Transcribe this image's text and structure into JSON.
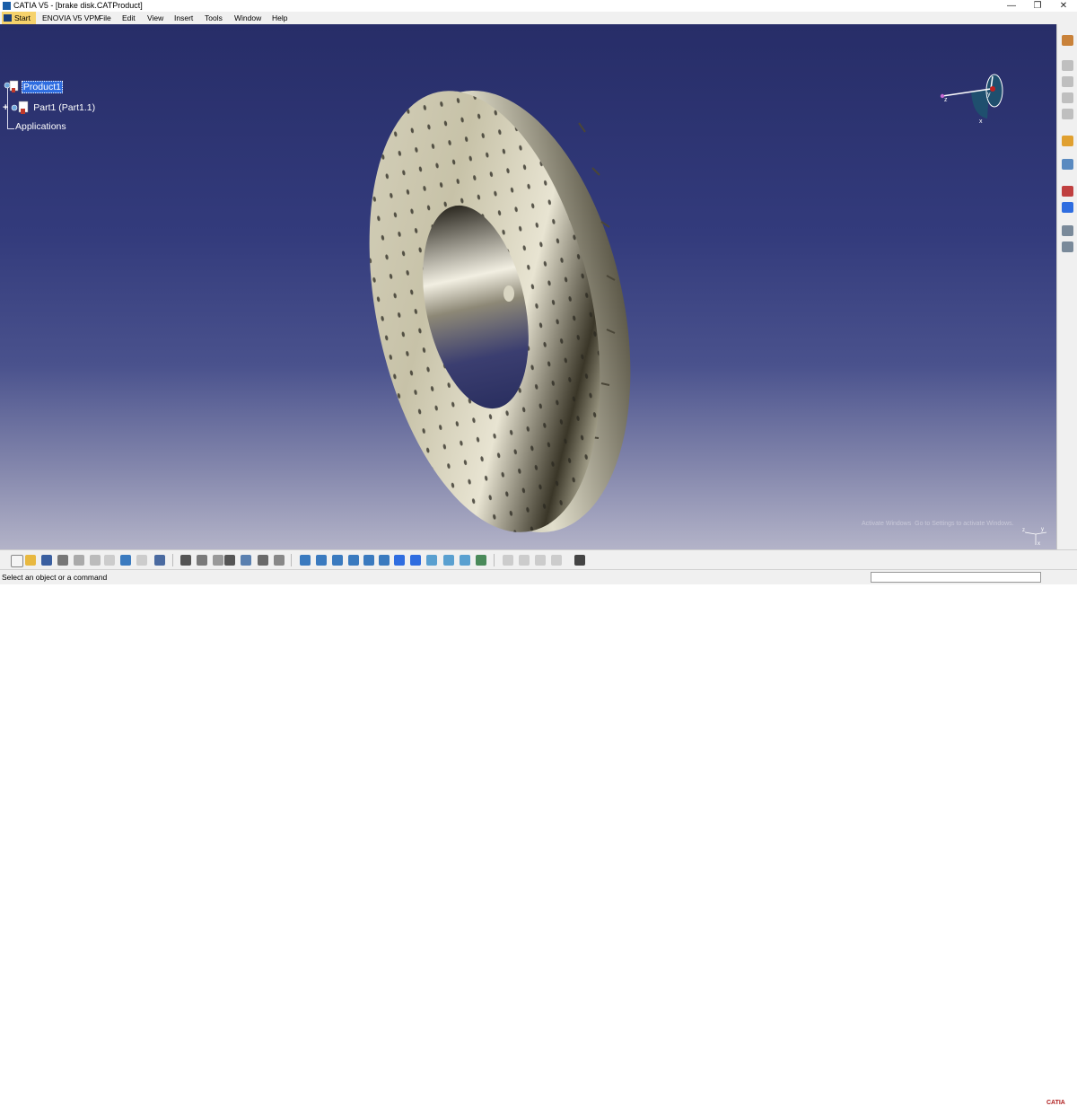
{
  "window": {
    "title": "CATIA V5 - [brake disk.CATProduct]",
    "minimize": "—",
    "restore": "❐",
    "close": "✕"
  },
  "menu": {
    "start": "Start",
    "items": [
      "ENOVIA V5 VPM",
      "File",
      "Edit",
      "View",
      "Insert",
      "Tools",
      "Window",
      "Help"
    ]
  },
  "tree": {
    "root": "Product1",
    "part": "Part1 (Part1.1)",
    "applications": "Applications"
  },
  "compass": {
    "x": "x",
    "y": "y",
    "z": "z"
  },
  "axis_triad": {
    "x": "x",
    "y": "y",
    "z": "z"
  },
  "watermark": "Activate Windows  Go to Settings to activate Windows.",
  "status": {
    "message": "Select an object or a command",
    "command_value": ""
  },
  "logo": {
    "text": "CATIA"
  },
  "bottom_toolbar": {
    "buttons": [
      "new-icon",
      "open-icon",
      "save-icon",
      "print-icon",
      "cut-icon",
      "copy-icon",
      "paste-icon",
      "undo-icon",
      "redo-icon",
      "whats-this-icon",
      "formula-icon",
      "knowledge-icon",
      "filter-icon",
      "catalog-icon",
      "tree-expand-icon",
      "fit-all-icon",
      "pan-icon",
      "rotate-icon",
      "zoom-in-icon",
      "zoom-out-icon",
      "normal-view-icon",
      "iso-view-icon",
      "shading-icon",
      "hide-show-icon",
      "swap-icon",
      "measure-icon",
      "snap-icon",
      "analysis-icon",
      "sketch-icon",
      "camera-icon"
    ]
  },
  "right_toolbar": {
    "buttons": [
      "assembly-icon",
      "component-icon",
      "product-icon",
      "part-icon",
      "existing-icon",
      "move-icon",
      "manipulate-icon",
      "constraint-icon",
      "update-icon",
      "explode-icon",
      "snap-icon",
      "section-icon"
    ]
  },
  "colors": {
    "accent": "#2f6de0",
    "viewport_top": "#272d68",
    "viewport_bottom": "#b3b3c8"
  }
}
